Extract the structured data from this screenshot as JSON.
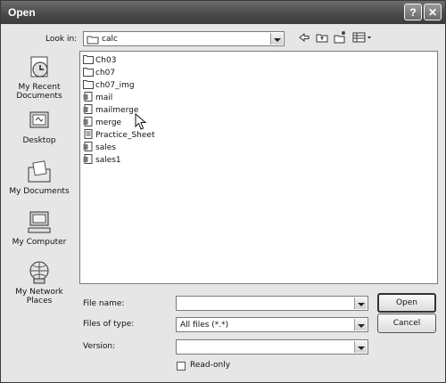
{
  "window": {
    "title": "Open",
    "help_glyph": "?",
    "close_glyph": "✕"
  },
  "lookin": {
    "label": "Look in:",
    "value": "calc"
  },
  "toolbar": {
    "icons": [
      "back-icon",
      "up-folder-icon",
      "new-folder-icon",
      "views-menu-icon"
    ]
  },
  "places": [
    {
      "label": "My Recent Documents",
      "icon": "recent-documents-icon"
    },
    {
      "label": "Desktop",
      "icon": "desktop-icon"
    },
    {
      "label": "My Documents",
      "icon": "my-documents-icon"
    },
    {
      "label": "My Computer",
      "icon": "my-computer-icon"
    },
    {
      "label": "My Network Places",
      "icon": "network-places-icon"
    }
  ],
  "files": [
    {
      "name": "Ch03",
      "kind": "folder"
    },
    {
      "name": "ch07",
      "kind": "folder"
    },
    {
      "name": "ch07_img",
      "kind": "folder"
    },
    {
      "name": "mail",
      "kind": "file"
    },
    {
      "name": "mailmerge",
      "kind": "file"
    },
    {
      "name": "merge",
      "kind": "file"
    },
    {
      "name": "Practice_Sheet",
      "kind": "file"
    },
    {
      "name": "sales",
      "kind": "file"
    },
    {
      "name": "sales1",
      "kind": "file"
    }
  ],
  "form": {
    "filename_label": "File name:",
    "filename_value": "",
    "filetype_label": "Files of type:",
    "filetype_value": "All files (*.*)",
    "version_label": "Version:",
    "version_value": "",
    "readonly_label": "Read-only",
    "readonly_checked": false
  },
  "buttons": {
    "open": "Open",
    "cancel": "Cancel"
  }
}
